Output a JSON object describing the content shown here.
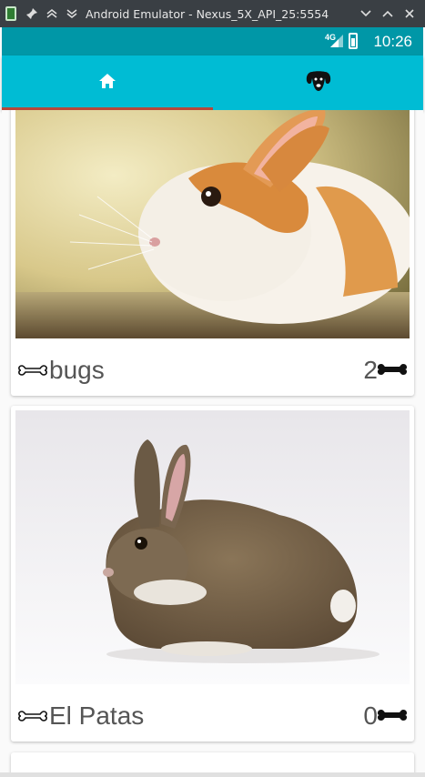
{
  "window": {
    "title": "Android Emulator - Nexus_5X_API_25:5554"
  },
  "status_bar": {
    "network": "4G",
    "time": "10:26"
  },
  "tabs": [
    {
      "icon": "home-icon",
      "selected": true
    },
    {
      "icon": "dog-icon",
      "selected": false
    }
  ],
  "pets": [
    {
      "name": "bugs",
      "count": "2",
      "image": "orange-white-rabbit"
    },
    {
      "name": "El Patas",
      "count": "0",
      "image": "brown-wild-rabbit"
    }
  ],
  "colors": {
    "status_bar": "#0097a7",
    "tab_bar": "#00bcd4",
    "tab_indicator": "#b8473a"
  }
}
